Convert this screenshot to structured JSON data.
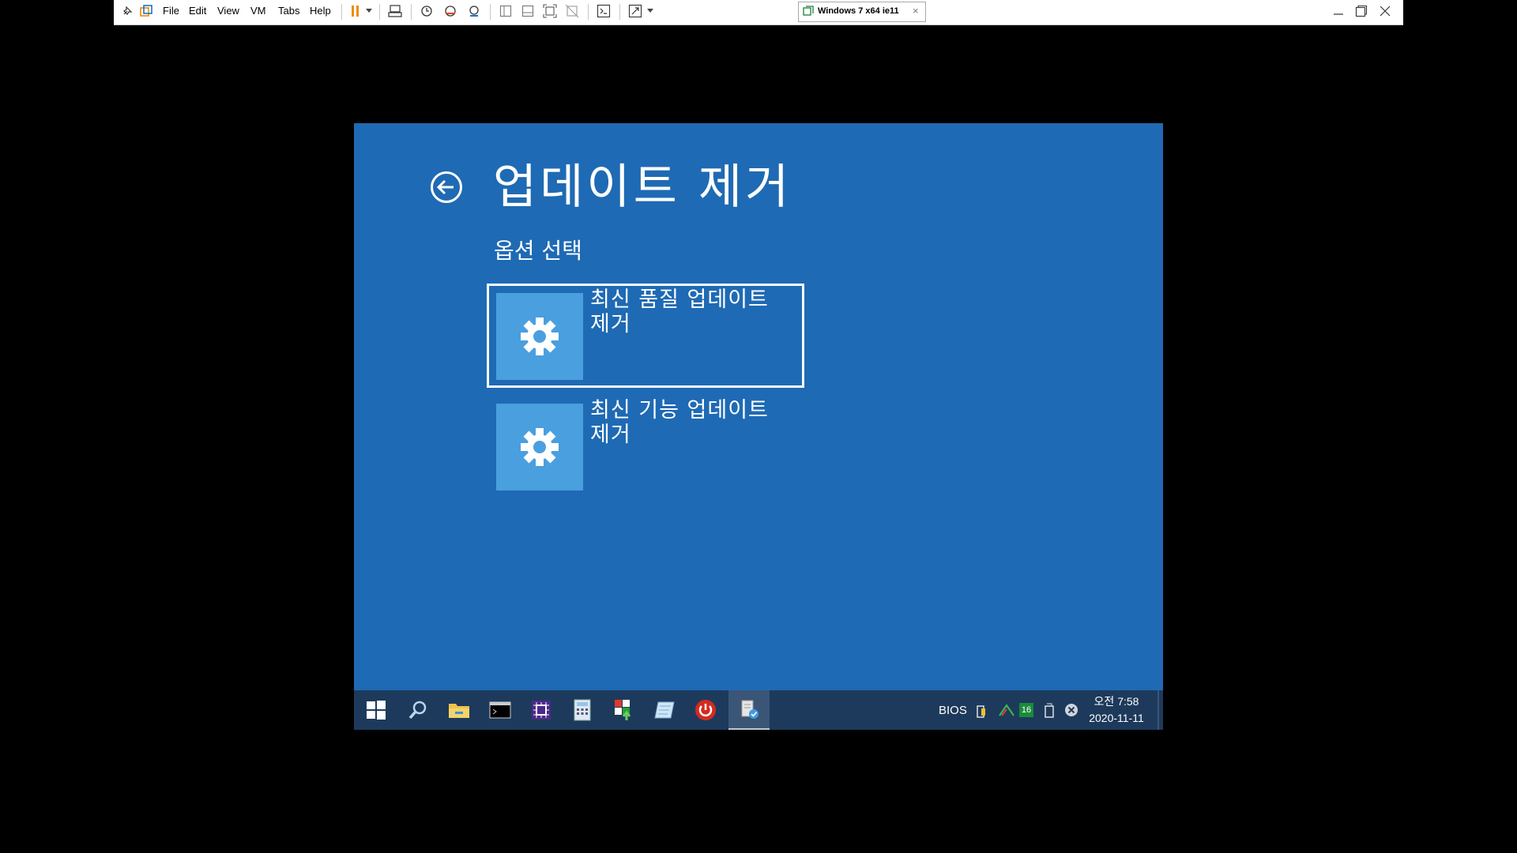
{
  "toolbar": {
    "menus": [
      "File",
      "Edit",
      "View",
      "VM",
      "Tabs",
      "Help"
    ],
    "tab_title": "Windows 7 x64 ie11",
    "tab_close": "×"
  },
  "recovery": {
    "title": "업데이트 제거",
    "subtitle": "옵션 선택",
    "options": [
      {
        "label": "최신 품질 업데이트 제거",
        "icon": "gear-icon",
        "selected": true
      },
      {
        "label": "최신 기능 업데이트 제거",
        "icon": "gear-icon",
        "selected": false
      }
    ]
  },
  "taskbar": {
    "apps": [
      "start-icon",
      "search-icon",
      "file-explorer-icon",
      "command-prompt-icon",
      "chip-tool-icon",
      "calculator-icon",
      "installer-icon",
      "notepad-icon",
      "power-icon",
      "tool-icon"
    ],
    "tray": {
      "bios_label": "BIOS",
      "badge": "16",
      "time": "오전 7:58",
      "date": "2020-11-11"
    }
  },
  "colors": {
    "background": "#1f6ab4",
    "tile": "#4a9fdf",
    "taskbar": "#1d3a5c"
  }
}
